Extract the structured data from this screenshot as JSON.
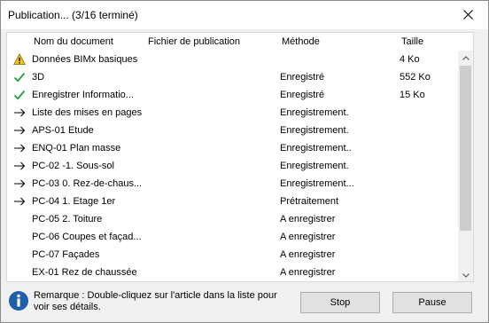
{
  "window": {
    "title": "Publication... (3/16 terminé)"
  },
  "columns": {
    "name": "Nom du document",
    "file": "Fichier de publication",
    "method": "Méthode",
    "size": "Taille"
  },
  "rows": [
    {
      "icon": "warning-icon",
      "name": "Données BIMx basiques",
      "method": "",
      "size": "4 Ko"
    },
    {
      "icon": "checkmark-icon",
      "name": "3D",
      "method": "Enregistré",
      "size": "552 Ko"
    },
    {
      "icon": "checkmark-icon",
      "name": "Enregistrer Informatio...",
      "method": "Enregistré",
      "size": "15 Ko"
    },
    {
      "icon": "arrow-right-icon",
      "name": "Liste des mises en pages",
      "method": "Enregistrement.",
      "size": ""
    },
    {
      "icon": "arrow-right-icon",
      "name": "APS-01 Etude",
      "method": "Enregistrement.",
      "size": ""
    },
    {
      "icon": "arrow-right-icon",
      "name": "ENQ-01 Plan masse",
      "method": "Enregistrement..",
      "size": ""
    },
    {
      "icon": "arrow-right-icon",
      "name": "PC-02 -1. Sous-sol",
      "method": "Enregistrement.",
      "size": ""
    },
    {
      "icon": "arrow-right-icon",
      "name": "PC-03 0. Rez-de-chaus...",
      "method": "Enregistrement...",
      "size": ""
    },
    {
      "icon": "arrow-right-icon",
      "name": "PC-04 1. Etage 1er",
      "method": "Prétraitement",
      "size": ""
    },
    {
      "icon": "",
      "name": "PC-05 2. Toiture",
      "method": "A enregistrer",
      "size": ""
    },
    {
      "icon": "",
      "name": "PC-06 Coupes et façad...",
      "method": "A enregistrer",
      "size": ""
    },
    {
      "icon": "",
      "name": "PC-07 Façades",
      "method": "A enregistrer",
      "size": ""
    },
    {
      "icon": "",
      "name": "EX-01 Rez de chaussée",
      "method": "A enregistrer",
      "size": ""
    }
  ],
  "footer": {
    "remark": "Remarque : Double-cliquez sur l'article dans la liste pour voir ses détails.",
    "stop_label": "Stop",
    "pause_label": "Pause"
  },
  "colors": {
    "check": "#1e9e3c",
    "warning": "#f5c518",
    "info": "#1f5fa8"
  }
}
